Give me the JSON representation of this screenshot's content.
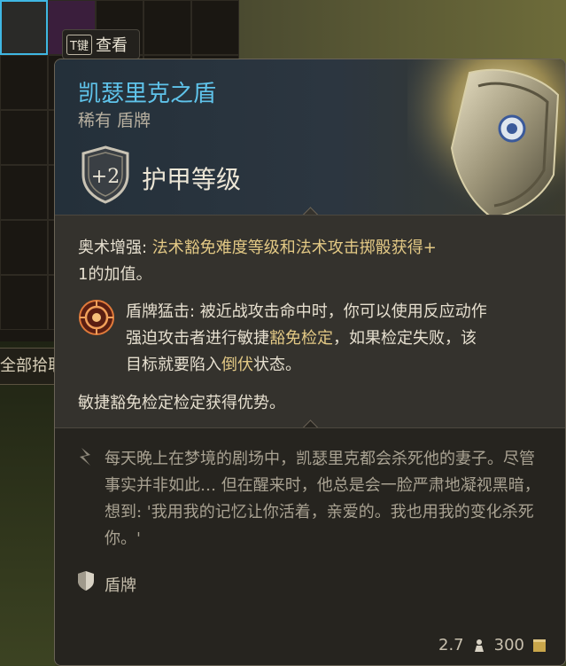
{
  "background": {
    "hint_key": "T键",
    "hint_label": "查看",
    "pickup_tab": "全部拾取"
  },
  "tooltip": {
    "name": "凯瑟里克之盾",
    "subtitle": "稀有 盾牌",
    "armor_value": "+2",
    "armor_label": "护甲等级",
    "arcane_prefix": "奥术增强: ",
    "arcane_gold": "法术豁免难度等级和法术攻击掷骰获得+",
    "arcane_line2": "1的加值。",
    "bash_title": "盾牌猛击: ",
    "bash_line1_rest": "被近战攻击命中时，你可以使用反应动作",
    "bash_line2_a": "强迫攻击者进行敏捷",
    "bash_line2_gold": "豁免检定",
    "bash_line2_b": "，如果检定失败，该",
    "bash_line3_a": "目标就要陷入",
    "bash_line3_gold": "倒伏",
    "bash_line3_b": "状态。",
    "advantage": "敏捷豁免检定检定获得优势。",
    "lore": "每天晚上在梦境的剧场中，凯瑟里克都会杀死他的妻子。尽管事实并非如此… 但在醒来时，他总是会一脸严肃地凝视黑暗，想到: '我用我的记忆让你活着，亲爱的。我也用我的变化杀死你。'",
    "type": "盾牌",
    "weight": "2.7",
    "value": "300"
  },
  "colors": {
    "name": "#5fc3ea",
    "gold_text": "#e3c985",
    "body_text": "#e6dfcf",
    "lore_text": "#a9a292"
  },
  "icons": [
    "shield-armor-icon",
    "shield-bash-icon",
    "quote-icon",
    "shield-type-icon",
    "weight-icon",
    "coin-icon"
  ]
}
